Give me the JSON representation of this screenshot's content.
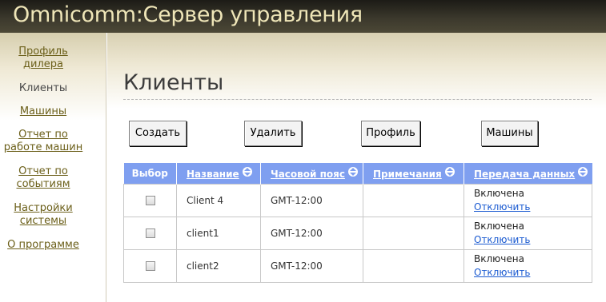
{
  "header": {
    "title": "Omnicomm:Сервер управления"
  },
  "sidebar": {
    "items": [
      {
        "label": "Профиль дилера",
        "active": false
      },
      {
        "label": "Клиенты",
        "active": true
      },
      {
        "label": "Машины",
        "active": false
      },
      {
        "label": "Отчет по работе машин",
        "active": false
      },
      {
        "label": "Отчет по событиям",
        "active": false
      },
      {
        "label": "Настройки системы",
        "active": false
      },
      {
        "label": "О программе",
        "active": false
      }
    ]
  },
  "main": {
    "title": "Клиенты",
    "buttons": {
      "create": "Создать",
      "delete": "Удалить",
      "profile": "Профиль",
      "machines": "Машины"
    },
    "table": {
      "columns": [
        "Выбор",
        "Название",
        "Часовой пояс",
        "Примечания",
        "Передача данных"
      ],
      "sortable_icon": "sort-circle-arrows-icon",
      "rows": [
        {
          "name": "Client 4",
          "timezone": "GMT-12:00",
          "notes": "",
          "status": "Включена",
          "action": "Отключить"
        },
        {
          "name": "client1",
          "timezone": "GMT-12:00",
          "notes": "",
          "status": "Включена",
          "action": "Отключить"
        },
        {
          "name": "client2",
          "timezone": "GMT-12:00",
          "notes": "",
          "status": "Включена",
          "action": "Отключить"
        }
      ]
    }
  },
  "colors": {
    "header_text": "#efe6b8",
    "nav_link": "#6b5f19",
    "table_header": "#7f9ff0",
    "action_link": "#1a5ad1"
  }
}
